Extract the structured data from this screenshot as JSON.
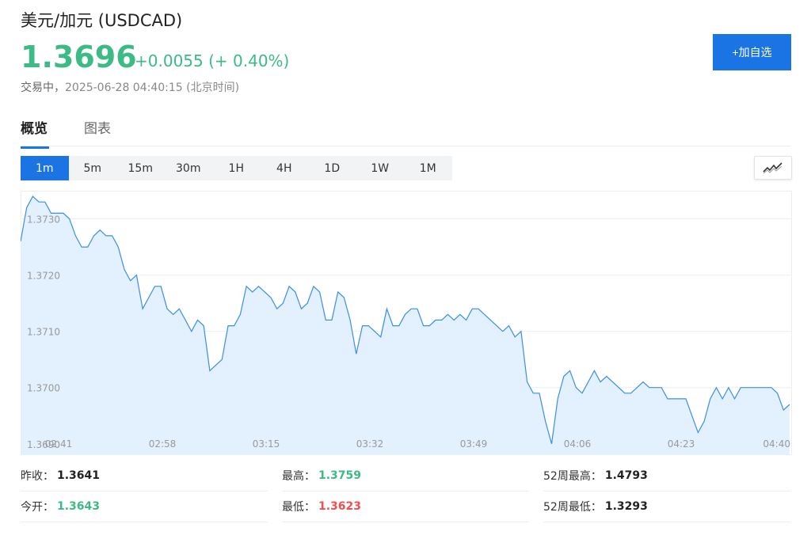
{
  "header": {
    "title": "美元/加元  (USDCAD)",
    "price": "1.3696",
    "change": "+0.0055 (+ 0.40%)",
    "status_label": "交易中，",
    "timestamp": "2025-06-28 04:40:15  (北京时间)",
    "add_button": "+加自选"
  },
  "tabs": [
    {
      "label": "概览",
      "active": true
    },
    {
      "label": "图表",
      "active": false
    }
  ],
  "periods": [
    {
      "label": "1m",
      "active": true
    },
    {
      "label": "5m"
    },
    {
      "label": "15m"
    },
    {
      "label": "30m"
    },
    {
      "label": "1H"
    },
    {
      "label": "4H"
    },
    {
      "label": "1D"
    },
    {
      "label": "1W"
    },
    {
      "label": "1M"
    }
  ],
  "chart_data": {
    "type": "area",
    "y_ticks": [
      "1.3730",
      "1.3720",
      "1.3710",
      "1.3700",
      "1.3690"
    ],
    "x_ticks": [
      "02:41",
      "02:58",
      "03:15",
      "03:32",
      "03:49",
      "04:06",
      "04:23",
      "04:40"
    ],
    "ylim": [
      1.3688,
      1.3735
    ],
    "line_color": "#3a8ee6",
    "fill_color": "#e3f0fd",
    "values": [
      1.3726,
      1.3732,
      1.3734,
      1.3733,
      1.3733,
      1.3731,
      1.3731,
      1.3731,
      1.373,
      1.3727,
      1.3725,
      1.3725,
      1.3727,
      1.3728,
      1.3727,
      1.3727,
      1.3725,
      1.3721,
      1.3719,
      1.372,
      1.3714,
      1.3716,
      1.3718,
      1.3718,
      1.3714,
      1.3713,
      1.3714,
      1.3712,
      1.371,
      1.3712,
      1.3711,
      1.3703,
      1.3704,
      1.3705,
      1.3711,
      1.3711,
      1.3713,
      1.3718,
      1.3717,
      1.3718,
      1.3717,
      1.3716,
      1.3714,
      1.3715,
      1.3718,
      1.3717,
      1.3714,
      1.3715,
      1.3718,
      1.3717,
      1.3712,
      1.3712,
      1.3717,
      1.3716,
      1.3712,
      1.3706,
      1.3711,
      1.3711,
      1.371,
      1.3709,
      1.3714,
      1.3711,
      1.3711,
      1.3713,
      1.3714,
      1.3714,
      1.3711,
      1.3711,
      1.3712,
      1.3712,
      1.3713,
      1.3712,
      1.3713,
      1.3712,
      1.3714,
      1.3714,
      1.3713,
      1.3712,
      1.3711,
      1.371,
      1.3711,
      1.3709,
      1.371,
      1.3701,
      1.3699,
      1.3699,
      1.3694,
      1.369,
      1.3698,
      1.3702,
      1.3703,
      1.37,
      1.3699,
      1.3701,
      1.3703,
      1.3701,
      1.3702,
      1.3701,
      1.37,
      1.3699,
      1.3699,
      1.37,
      1.3701,
      1.37,
      1.37,
      1.37,
      1.3698,
      1.3698,
      1.3698,
      1.3698,
      1.3695,
      1.3692,
      1.3694,
      1.3698,
      1.37,
      1.3698,
      1.37,
      1.3698,
      1.37,
      1.37,
      1.37,
      1.37,
      1.37,
      1.37,
      1.3699,
      1.3696,
      1.3697
    ]
  },
  "stats": {
    "prev_close": {
      "label": "昨收：",
      "value": "1.3641"
    },
    "high": {
      "label": "最高：",
      "value": "1.3759"
    },
    "wk52_high": {
      "label": "52周最高：",
      "value": "1.4793"
    },
    "open": {
      "label": "今开：",
      "value": "1.3643"
    },
    "low": {
      "label": "最低：",
      "value": "1.3623"
    },
    "wk52_low": {
      "label": "52周最低：",
      "value": "1.3293"
    }
  }
}
